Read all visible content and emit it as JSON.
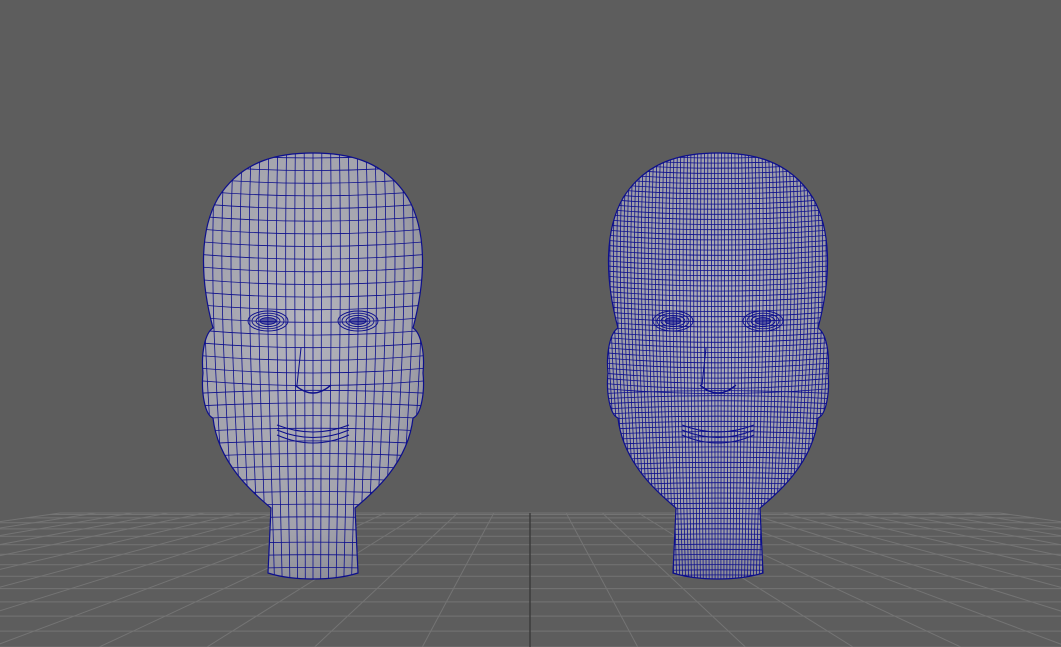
{
  "viewport": {
    "background_color": "#5d5d5d",
    "grid_color": "#747474",
    "grid_axis_color": "#3a3a3a",
    "mesh_fill_color": "#a4a4ad",
    "mesh_shade_color": "#7b7b84",
    "wire_color": "#0d0f8c"
  },
  "objects": [
    {
      "name": "low-poly-head",
      "wire_density": "low",
      "icon": "mesh-icon"
    },
    {
      "name": "high-poly-head",
      "wire_density": "high",
      "icon": "mesh-icon"
    }
  ]
}
